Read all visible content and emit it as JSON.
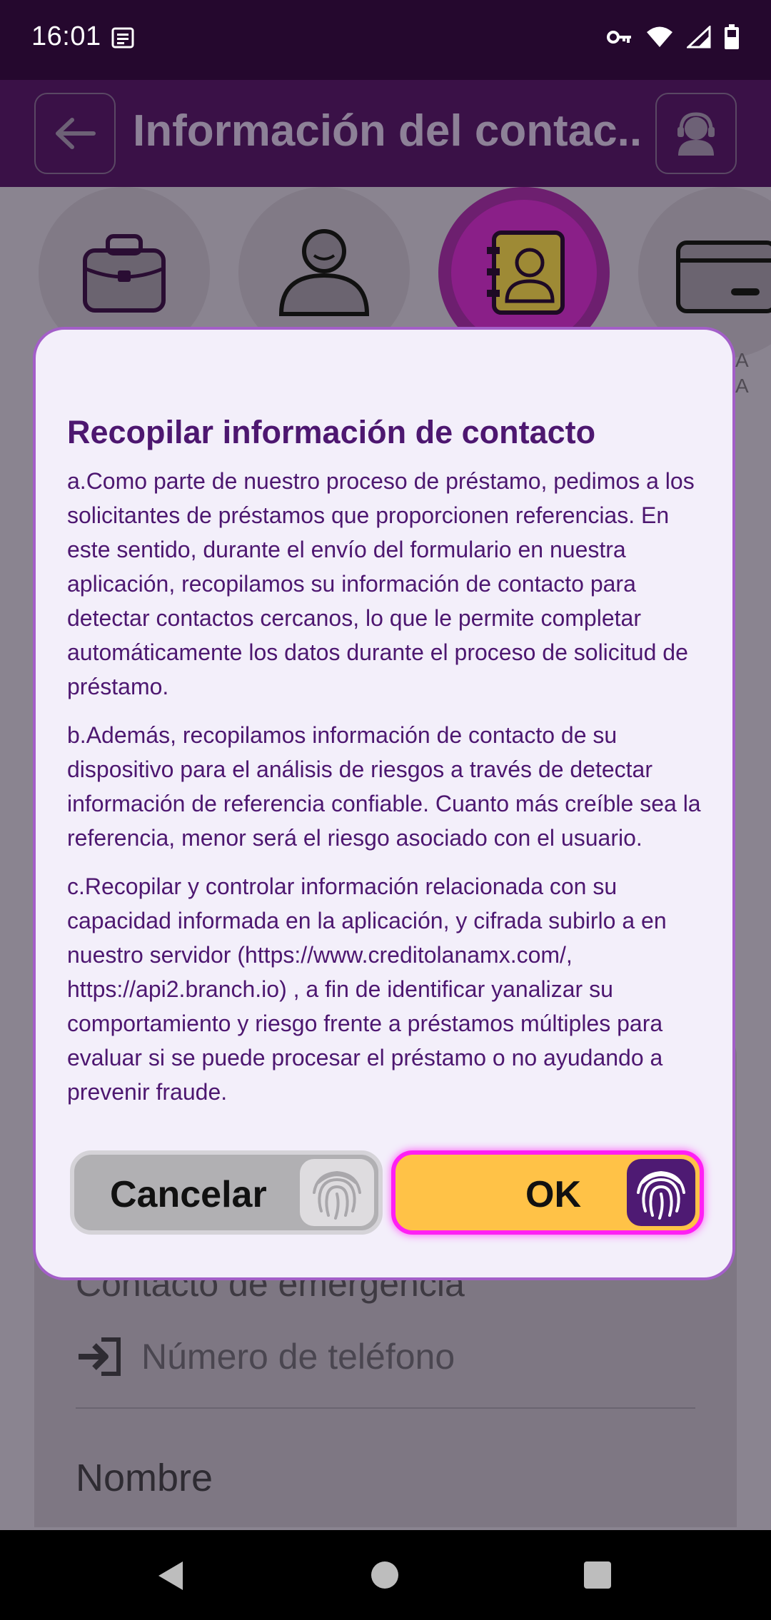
{
  "status_bar": {
    "time": "16:01"
  },
  "app_bar": {
    "title": "Información del contac.."
  },
  "steps": [
    {
      "icon": "briefcase-icon",
      "active": false
    },
    {
      "icon": "person-icon",
      "active": false
    },
    {
      "icon": "contact-book-icon",
      "active": true
    },
    {
      "icon": "card-icon",
      "active": false
    }
  ],
  "step_partial_label": "A\nA",
  "background": {
    "emergency_title": "Contacto de emergencia",
    "phone_label": "Número de teléfono",
    "name_label": "Nombre"
  },
  "dialog": {
    "title": "Recopilar información de contacto",
    "paragraphs": [
      "a.Como parte de nuestro proceso de préstamo, pedimos a los solicitantes de préstamos que proporcionen referencias. En este sentido, durante el envío del formulario en nuestra aplicación, recopilamos su información de contacto para detectar contactos cercanos, lo que le permite completar automáticamente los datos durante el proceso de solicitud de préstamo.",
      "b.Además, recopilamos información de contacto de su dispositivo para el análisis de riesgos a través de detectar información de referencia confiable. Cuanto más creíble sea la referencia, menor será el riesgo asociado con el usuario.",
      "c.Recopilar y controlar información relacionada con su capacidad informada en la aplicación, y cifrada subirlo a en nuestro servidor (https://www.creditolanamx.com/, https://api2.branch.io) , a fin de identificar yanalizar su comportamiento y riesgo frente a préstamos múltiples para evaluar si se puede procesar el préstamo o no ayudando a prevenir fraude."
    ],
    "cancel_label": "Cancelar",
    "ok_label": "OK"
  },
  "colors": {
    "dialog_text": "#4d1770",
    "ok_bg": "#ffc247",
    "ok_border": "#ff1ff4",
    "app_bar": "#3a1147"
  }
}
